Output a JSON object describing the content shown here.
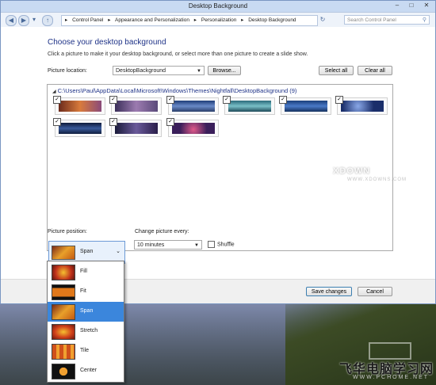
{
  "window": {
    "title": "Desktop Background",
    "controls": [
      "–",
      "□",
      "✕"
    ]
  },
  "address": {
    "breadcrumbs": [
      "Control Panel",
      "Appearance and Personalization",
      "Personalization",
      "Desktop Background"
    ],
    "search_placeholder": "Search Control Panel"
  },
  "main": {
    "heading": "Choose your desktop background",
    "description": "Click a picture to make it your desktop background, or select more than one picture to create a slide show.",
    "location_label": "Picture location:",
    "location_value": "DesktopBackground",
    "browse_label": "Browse...",
    "select_all_label": "Select all",
    "clear_all_label": "Clear all",
    "folder_path": "C:\\Users\\Paul\\AppData\\Local\\Microsoft\\Windows\\Themes\\Nightfall\\DesktopBackground (9)",
    "thumbnails_checked": [
      true,
      true,
      true,
      true,
      true,
      true,
      true,
      true,
      true
    ]
  },
  "position": {
    "label": "Picture position:",
    "selected": "Span",
    "options": [
      "Fill",
      "Fit",
      "Span",
      "Stretch",
      "Tile",
      "Center"
    ]
  },
  "interval": {
    "label": "Change picture every:",
    "value": "10 minutes",
    "shuffle_label": "Shuffle"
  },
  "footer": {
    "save_label": "Save changes",
    "cancel_label": "Cancel"
  },
  "watermark": {
    "text": "飞华电脑学习网",
    "url": "WWW.PCHOME.NET",
    "brand": "XDOWN",
    "brand_url": "WWW.XDOWNS.COM"
  },
  "colors": {
    "accent": "#3b86dc",
    "heading": "#1e3287"
  }
}
